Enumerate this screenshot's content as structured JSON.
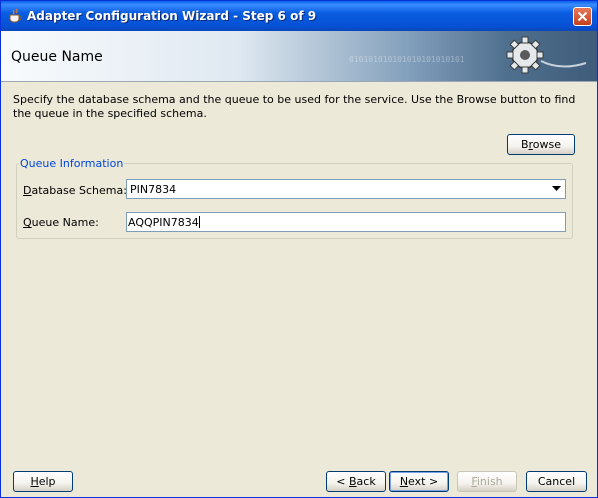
{
  "window": {
    "title": "Adapter Configuration Wizard - Step 6 of 9"
  },
  "banner": {
    "heading": "Queue Name",
    "decoration_binary": "010101010101010101010101"
  },
  "description": "Specify the database schema and the queue to be used for the service. Use the Browse button to find the queue in the specified schema.",
  "browse_button": {
    "pre": "B",
    "accel": "r",
    "post": "owse"
  },
  "queue_info": {
    "legend": "Queue Information",
    "schema_label": {
      "accel": "D",
      "post": "atabase Schema:"
    },
    "schema_value": "PIN7834",
    "queue_label": {
      "accel": "Q",
      "post": "ueue Name:"
    },
    "queue_value": "AQQPIN7834"
  },
  "footer": {
    "help": {
      "accel": "H",
      "post": "elp"
    },
    "back": {
      "pre": "< ",
      "accel": "B",
      "post": "ack"
    },
    "next": {
      "accel": "N",
      "post": "ext >"
    },
    "finish": {
      "accel": "F",
      "post": "inish"
    },
    "cancel": "Cancel"
  },
  "colors": {
    "titlebar": "#0a5de0",
    "legend": "#0046d5",
    "button_border": "#003c74"
  }
}
